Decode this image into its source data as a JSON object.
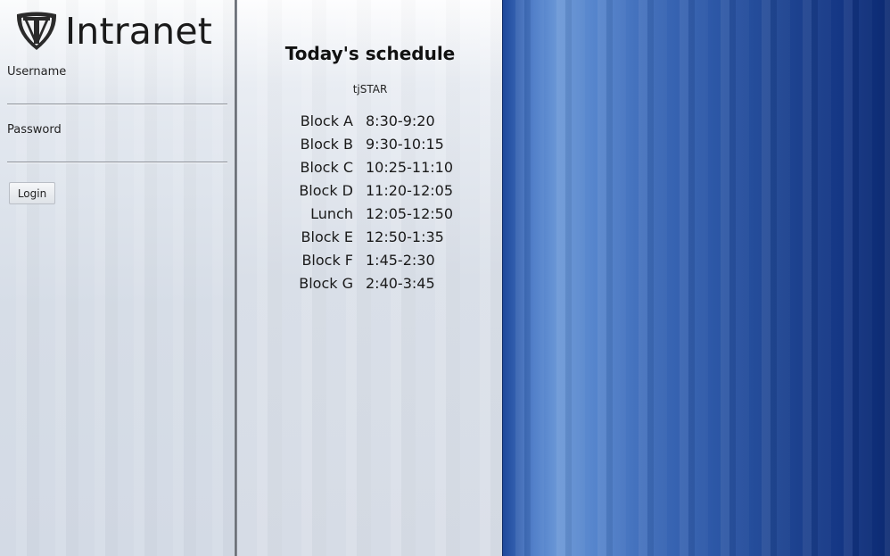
{
  "brand": {
    "title": "Intranet",
    "logo_icon": "tj-shield-logo-icon"
  },
  "login": {
    "username_label": "Username",
    "username_value": "",
    "password_label": "Password",
    "password_value": "",
    "login_button_label": "Login"
  },
  "schedule": {
    "title": "Today's schedule",
    "day_type": "tjSTAR",
    "rows": [
      {
        "name": "Block A",
        "time": "8:30-9:20"
      },
      {
        "name": "Block B",
        "time": "9:30-10:15"
      },
      {
        "name": "Block C",
        "time": "10:25-11:10"
      },
      {
        "name": "Block D",
        "time": "11:20-12:05"
      },
      {
        "name": "Lunch",
        "time": "12:05-12:50"
      },
      {
        "name": "Block E",
        "time": "12:50-1:35"
      },
      {
        "name": "Block F",
        "time": "1:45-2:30"
      },
      {
        "name": "Block G",
        "time": "2:40-3:45"
      }
    ]
  },
  "colors": {
    "background_blue": "#2c57a6",
    "panel_light": "#d9dfe8"
  }
}
